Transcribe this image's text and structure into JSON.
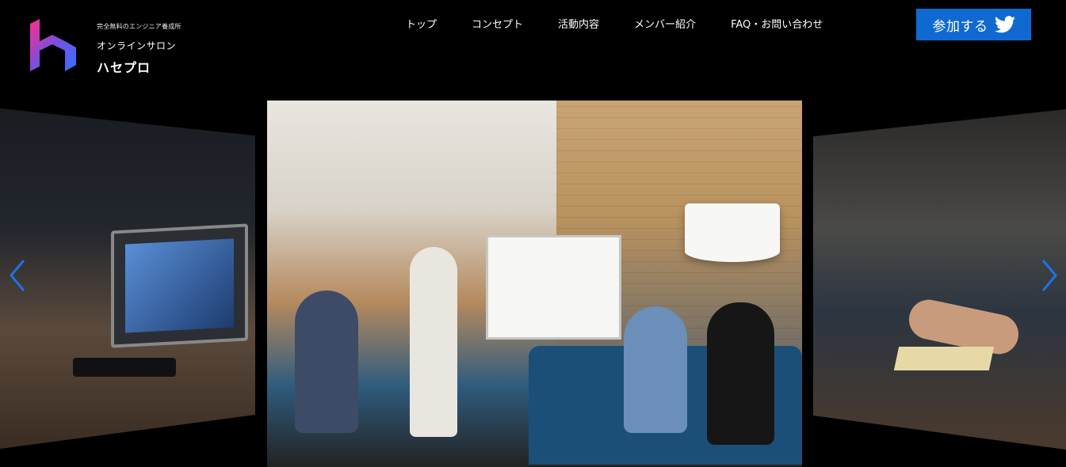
{
  "brand": {
    "tagline": "完全無料のエンジニア養成所",
    "subtitle": "オンラインサロン",
    "name": "ハセプロ",
    "logo_icon": "hasepro-logo-icon"
  },
  "nav": {
    "items": [
      {
        "label": "トップ"
      },
      {
        "label": "コンセプト"
      },
      {
        "label": "活動内容"
      },
      {
        "label": "メンバー紹介"
      },
      {
        "label": "FAQ・お問い合わせ"
      }
    ]
  },
  "cta": {
    "label": "参加する",
    "icon": "twitter-icon",
    "color": "#1069d0"
  },
  "slider": {
    "prev_icon": "chevron-left-icon",
    "next_icon": "chevron-right-icon",
    "arrow_color": "#1e72e6",
    "slides": [
      {
        "position": "left",
        "image": "laptop-on-desk-photo"
      },
      {
        "position": "center",
        "image": "office-meeting-whiteboard-photo"
      },
      {
        "position": "right",
        "image": "people-writing-at-table-photo"
      }
    ]
  }
}
